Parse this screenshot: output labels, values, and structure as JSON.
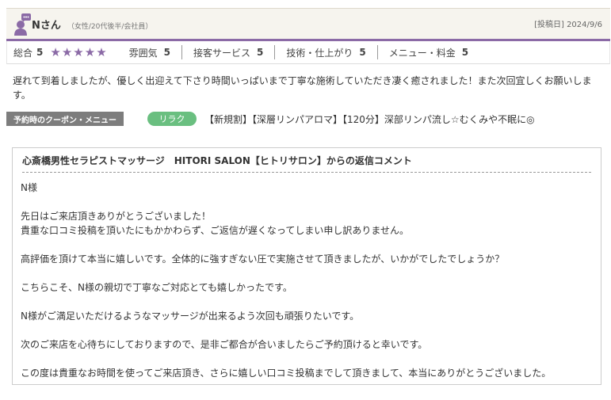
{
  "review": {
    "reviewer_name": "Nさん",
    "reviewer_meta": "（女性/20代後半/会社員）",
    "posted_date": "[投稿日] 2024/9/6",
    "ratings": {
      "total_label": "総合",
      "total_value": "5",
      "stars_filled": 5,
      "items": [
        {
          "label": "雰囲気",
          "value": "5"
        },
        {
          "label": "接客サービス",
          "value": "5"
        },
        {
          "label": "技術・仕上がり",
          "value": "5"
        },
        {
          "label": "メニュー・料金",
          "value": "5"
        }
      ]
    },
    "text": "遅れて到着しましたが、優しく出迎えて下さり時間いっぱいまで丁寧な施術していただき凄く癒されました！また次回宜しくお願いします。"
  },
  "coupon": {
    "label": "予約時のクーポン・メニュー",
    "tag": "リラク",
    "text": "【新規割】【深層リンパアロマ】【120分】深部リンパ流し☆むくみや不眠に◎"
  },
  "reply": {
    "title": "心斎橋男性セラピストマッサージ　HITORI SALON【ヒトリサロン】からの返信コメント",
    "lines": [
      "N様",
      "",
      "先日はご来店頂きありがとうございました！",
      "貴重な口コミ投稿を頂いたにもかかわらず、ご返信が遅くなってしまい申し訳ありません。",
      "",
      "高評価を頂けて本当に嬉しいです。全体的に強すぎない圧で実施させて頂きましたが、いかがでしたでしょうか？",
      "",
      "こちらこそ、N様の親切で丁寧なご対応とても嬉しかったです。",
      "",
      "N様がご満足いただけるようなマッサージが出来るよう次回も頑張りたいです。",
      "",
      "次のご来店を心待ちにしておりますので、是非ご都合が合いましたらご予約頂けると幸いです。",
      "",
      "この度は貴重なお時間を使ってご来店頂き、さらに嬉しい口コミ投稿までして頂きまして、本当にありがとうございました。"
    ]
  },
  "colors": {
    "accent": "#8b6aa6",
    "tag": "#6abf80",
    "label_bg": "#7d7d7d"
  }
}
